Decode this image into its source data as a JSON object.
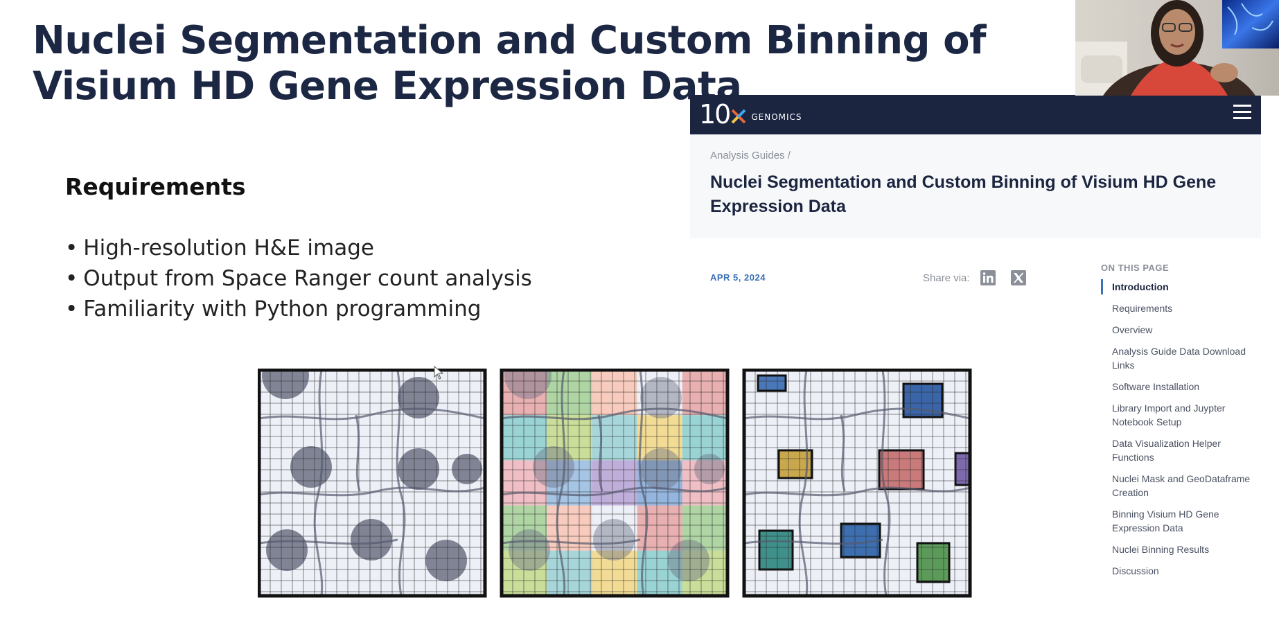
{
  "slide": {
    "title": "Nuclei Segmentation and Custom Binning of Visium HD Gene Expression Data",
    "requirements_heading": "Requirements",
    "requirements": [
      "High-resolution H&E image",
      "Output from Space Ranger count analysis",
      "Familiarity with Python programming"
    ]
  },
  "web": {
    "logo": {
      "text": "10",
      "word": "GENOMICS"
    },
    "menu_icon": "hamburger-menu-icon",
    "breadcrumb": "Analysis Guides /",
    "title": "Nuclei Segmentation and Custom Binning of Visium HD Gene Expression Data",
    "date": "APR 5, 2024",
    "share_label": "Share via:",
    "share_icons": [
      "linkedin-icon",
      "x-twitter-icon"
    ],
    "toc_heading": "ON THIS PAGE",
    "toc": [
      "Introduction",
      "Requirements",
      "Overview",
      "Analysis Guide Data Download Links",
      "Software Installation",
      "Library Import and Juypter Notebook Setup",
      "Data Visualization Helper Functions",
      "Nuclei Mask and GeoDataframe Creation",
      "Binning Visium HD Gene Expression Data",
      "Nuclei Binning Results",
      "Discussion"
    ],
    "toc_active": "Introduction"
  },
  "illustration": {
    "panels": [
      "tissue-grid-with-nuclei",
      "square-bins-colored",
      "nuclei-custom-bins"
    ]
  },
  "colors": {
    "title": "#1c2744",
    "nav_bg": "#1b2540",
    "accent_blue": "#3b6fb6",
    "nucleus": "#6c7184",
    "grid_bg": "#edf0f7"
  }
}
